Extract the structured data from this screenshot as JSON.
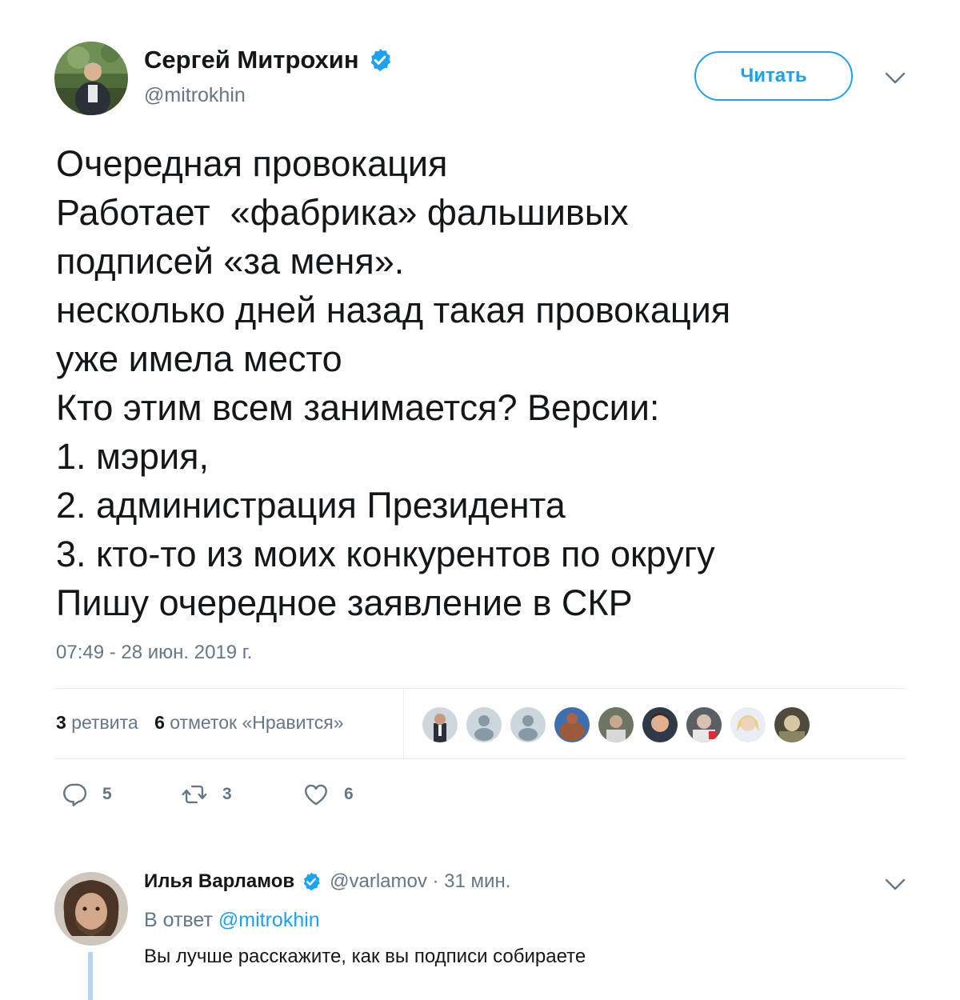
{
  "colors": {
    "accent": "#1da1f2",
    "muted": "#657786",
    "text": "#14171a",
    "divider": "#e6ecf0",
    "thread_line": "#b4d7f0"
  },
  "tweet": {
    "author_name": "Сергей Митрохин",
    "author_handle": "@mitrokhin",
    "verified_icon": "verified-badge-icon",
    "follow_label": "Читать",
    "lines": [
      "Очередная провокация",
      "Работает  «фабрика» фальшивых",
      "подписей «за меня».",
      "несколько дней назад такая провокация",
      "уже имела место",
      "Кто этим всем занимается? Версии:",
      "1. мэрия,",
      "2. администрация Президента",
      "3. кто-то из моих конкурентов по округу",
      "Пишу очередное заявление в СКР"
    ],
    "timestamp": "07:49 - 28 июн. 2019 г.",
    "stats": {
      "retweets_count": "3",
      "retweets_label": "ретвита",
      "likes_count": "6",
      "likes_label": "отметок «Нравится»"
    },
    "liker_count": 10,
    "actions": {
      "replies": "5",
      "retweets": "3",
      "likes": "6"
    }
  },
  "reply": {
    "author_name": "Илья Варламов",
    "author_handle": "@varlamov",
    "separator": " · ",
    "time": "31 мин.",
    "in_reply_prefix": "В ответ ",
    "in_reply_handle": "@mitrokhin",
    "text": "Вы лучше расскажите, как вы подписи собираете"
  }
}
